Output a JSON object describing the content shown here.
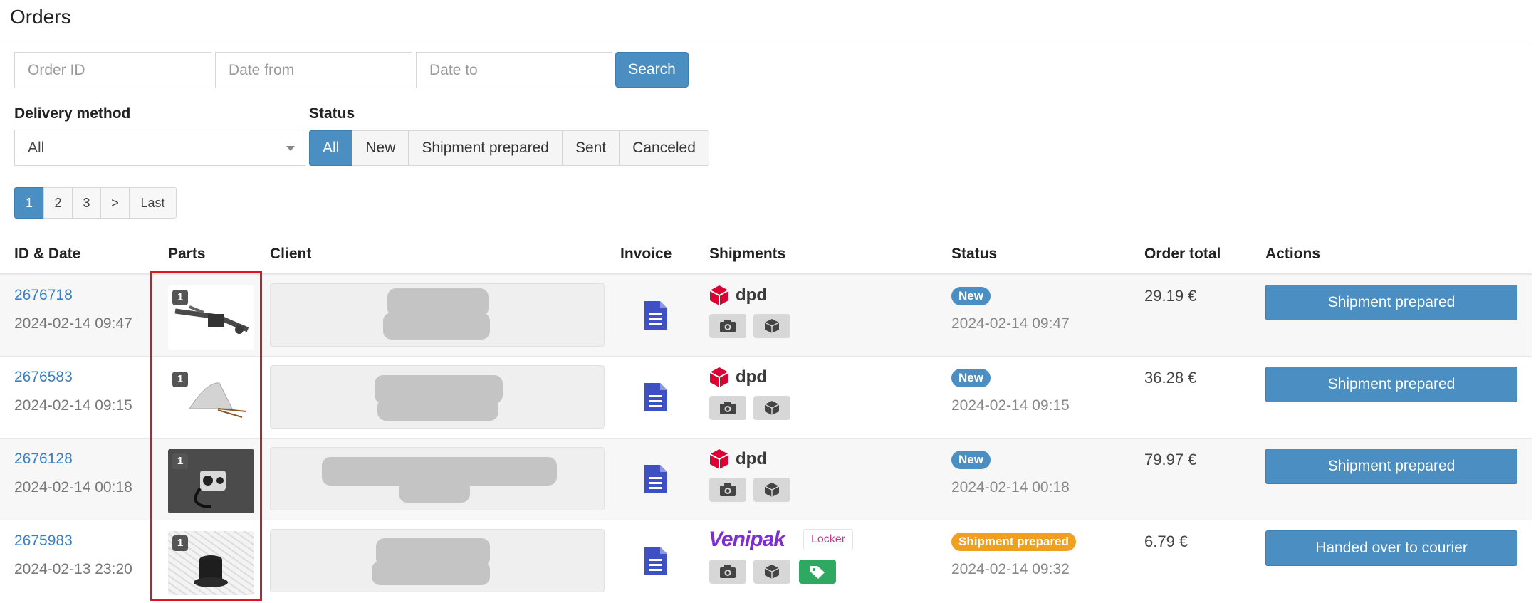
{
  "page": {
    "title": "Orders"
  },
  "filters": {
    "order_id_placeholder": "Order ID",
    "date_from_placeholder": "Date from",
    "date_to_placeholder": "Date to",
    "search_label": "Search",
    "delivery_label": "Delivery method",
    "delivery_value": "All",
    "status_label": "Status",
    "status_options": [
      "All",
      "New",
      "Shipment prepared",
      "Sent",
      "Canceled"
    ],
    "status_selected": "All"
  },
  "pagination": {
    "pages": [
      "1",
      "2",
      "3",
      ">",
      "Last"
    ],
    "current": "1"
  },
  "table": {
    "headers": [
      "ID & Date",
      "Parts",
      "Client",
      "Invoice",
      "Shipments",
      "Status",
      "Order total",
      "Actions"
    ],
    "rows": [
      {
        "id": "2676718",
        "date": "2024-02-14 09:47",
        "qty": "1",
        "carrier": "dpd",
        "status": "New",
        "status_date": "2024-02-14 09:47",
        "total": "29.19 €",
        "action": "Shipment prepared"
      },
      {
        "id": "2676583",
        "date": "2024-02-14 09:15",
        "qty": "1",
        "carrier": "dpd",
        "status": "New",
        "status_date": "2024-02-14 09:15",
        "total": "36.28 €",
        "action": "Shipment prepared"
      },
      {
        "id": "2676128",
        "date": "2024-02-14 00:18",
        "qty": "1",
        "carrier": "dpd",
        "status": "New",
        "status_date": "2024-02-14 00:18",
        "total": "79.97 €",
        "action": "Shipment prepared"
      },
      {
        "id": "2675983",
        "date": "2024-02-13 23:20",
        "qty": "1",
        "carrier": "Venipak",
        "carrier_tag": "Locker",
        "status": "Shipment prepared",
        "status_date": "2024-02-14 09:32",
        "total": "6.79 €",
        "action": "Handed over to courier"
      }
    ]
  },
  "colors": {
    "primary": "#4a8ec2",
    "link": "#3b7fc0",
    "status_new": "#4a8ec2",
    "status_prepared": "#f0a020",
    "dpd_red": "#dc0032",
    "venipak_purple": "#7b2fd0",
    "highlight_red": "#e3121d",
    "invoice_blue": "#3f4fc4",
    "label_green": "#2fa862"
  },
  "icons": {
    "invoice": "document-icon",
    "photo": "camera-icon",
    "package": "package-icon",
    "label": "tag-icon",
    "dropdown": "caret-down-icon"
  }
}
